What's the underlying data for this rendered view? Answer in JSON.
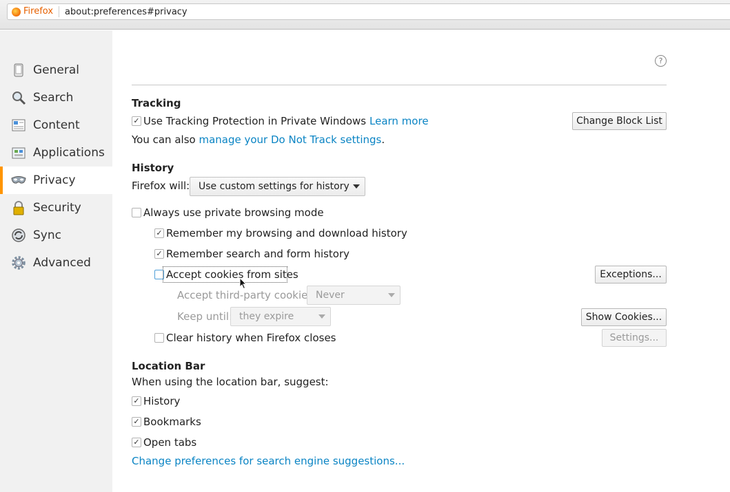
{
  "urlbar": {
    "identity": "Firefox",
    "url": "about:preferences#privacy"
  },
  "sidebar": {
    "items": [
      {
        "label": "General",
        "icon": "general-icon"
      },
      {
        "label": "Search",
        "icon": "search-icon"
      },
      {
        "label": "Content",
        "icon": "content-icon"
      },
      {
        "label": "Applications",
        "icon": "applications-icon"
      },
      {
        "label": "Privacy",
        "icon": "privacy-mask-icon",
        "active": true
      },
      {
        "label": "Security",
        "icon": "lock-icon"
      },
      {
        "label": "Sync",
        "icon": "sync-icon"
      },
      {
        "label": "Advanced",
        "icon": "gear-icon"
      }
    ]
  },
  "help_icon": "?",
  "tracking": {
    "heading": "Tracking",
    "protection_label": "Use Tracking Protection in Private Windows",
    "protection_checked": true,
    "learn_more": "Learn more",
    "change_block_list": "Change Block List",
    "dnt_prefix": "You can also ",
    "dnt_link": "manage your Do Not Track settings",
    "dnt_suffix": "."
  },
  "history": {
    "heading": "History",
    "firefox_will_label": "Firefox will:",
    "firefox_will_value": "Use custom settings for history",
    "always_private": {
      "label": "Always use private browsing mode",
      "checked": false
    },
    "remember_browsing": {
      "label": "Remember my browsing and download history",
      "checked": true
    },
    "remember_search": {
      "label": "Remember search and form history",
      "checked": true
    },
    "accept_cookies": {
      "label": "Accept cookies from sites",
      "checked": false
    },
    "exceptions": "Exceptions...",
    "third_party_label": "Accept third-party cookies:",
    "third_party_value": "Never",
    "keep_until_label": "Keep until:",
    "keep_until_value": "they expire",
    "show_cookies": "Show Cookies...",
    "clear_on_close": {
      "label": "Clear history when Firefox closes",
      "checked": false
    },
    "settings": "Settings..."
  },
  "location_bar": {
    "heading": "Location Bar",
    "suggest_label": "When using the location bar, suggest:",
    "history": {
      "label": "History",
      "checked": true
    },
    "bookmarks": {
      "label": "Bookmarks",
      "checked": true
    },
    "open_tabs": {
      "label": "Open tabs",
      "checked": true
    },
    "search_prefs_link": "Change preferences for search engine suggestions..."
  },
  "colors": {
    "accent": "#ff9500",
    "link": "#0a84c4",
    "sidebar_bg": "#f1f1f1"
  }
}
